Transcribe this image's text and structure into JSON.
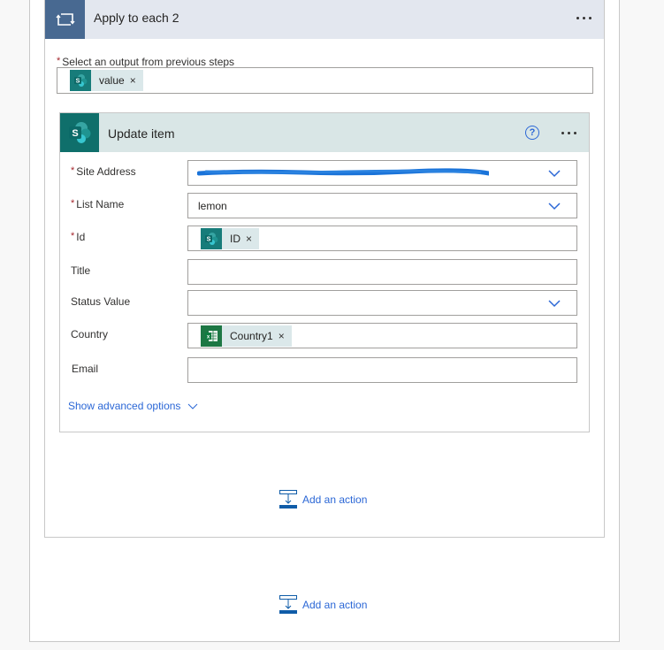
{
  "apply_to_each": {
    "title": "Apply to each 2",
    "icon": "loop-icon",
    "select_output_label": "Select an output from previous steps",
    "select_output_required": "*",
    "select_output_token": {
      "label": "value",
      "source_icon": "sharepoint-icon",
      "remove": "×"
    }
  },
  "update_item": {
    "title": "Update item",
    "icon": "sharepoint-icon",
    "help": "?",
    "fields": [
      {
        "label": "Site Address",
        "required": true,
        "value": "[redacted]",
        "type": "dropdown"
      },
      {
        "label": "List Name",
        "required": true,
        "value": "lemon",
        "type": "dropdown"
      },
      {
        "label": "Id",
        "required": true,
        "token": {
          "label": "ID",
          "source_icon": "sharepoint-icon",
          "remove": "×"
        },
        "type": "text"
      },
      {
        "label": "Title",
        "required": false,
        "value": "",
        "type": "text"
      },
      {
        "label": "Status Value",
        "required": false,
        "value": "",
        "type": "dropdown"
      },
      {
        "label": "Country",
        "required": false,
        "token": {
          "label": "Country1",
          "source_icon": "excel-icon",
          "remove": "×"
        },
        "type": "text"
      },
      {
        "label": "Email",
        "required": false,
        "value": "",
        "type": "text"
      }
    ],
    "required_mark": "*",
    "show_advanced": "Show advanced options"
  },
  "add_action_inner": "Add an action",
  "add_action_outer": "Add an action",
  "colors": {
    "loop_header": "#486991",
    "loop_header_bg": "#e3e7ef",
    "sharepoint": "#0f6f6b",
    "sharepoint_header_bg": "#d9e6e6",
    "excel": "#1d7744",
    "link": "#2b67d6",
    "required": "#a4262c"
  }
}
